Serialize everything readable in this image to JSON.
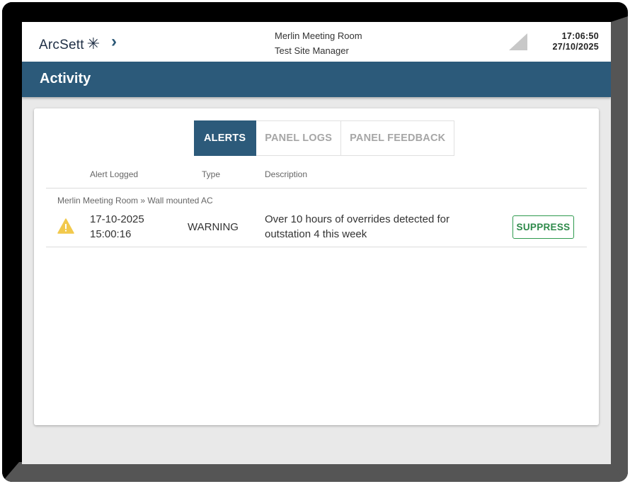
{
  "header": {
    "logo_text": "ArcSett",
    "logo_glyph": "✳",
    "room_name": "Merlin Meeting Room",
    "user_name": "Test Site Manager",
    "time": "17:06:50",
    "date": "27/10/2025"
  },
  "page": {
    "title": "Activity"
  },
  "tabs": [
    {
      "label": "ALERTS",
      "active": true
    },
    {
      "label": "PANEL LOGS",
      "active": false
    },
    {
      "label": "PANEL FEEDBACK",
      "active": false
    }
  ],
  "table": {
    "columns": [
      "Alert Logged",
      "Type",
      "Description"
    ],
    "groups": [
      {
        "label": "Merlin Meeting Room » Wall mounted AC",
        "rows": [
          {
            "date": "17-10-2025",
            "time": "15:00:16",
            "type": "WARNING",
            "description_line1": "Over 10 hours of overrides detected for",
            "description_line2": "outstation 4 this week",
            "action_label": "SUPPRESS"
          }
        ]
      }
    ]
  },
  "colors": {
    "brand": "#2c5a7a",
    "warning": "#f2c94c",
    "success": "#2e9a4e"
  },
  "icons": {
    "back": "chevron-right-icon",
    "signal": "signal-icon",
    "alert": "warning-icon"
  }
}
